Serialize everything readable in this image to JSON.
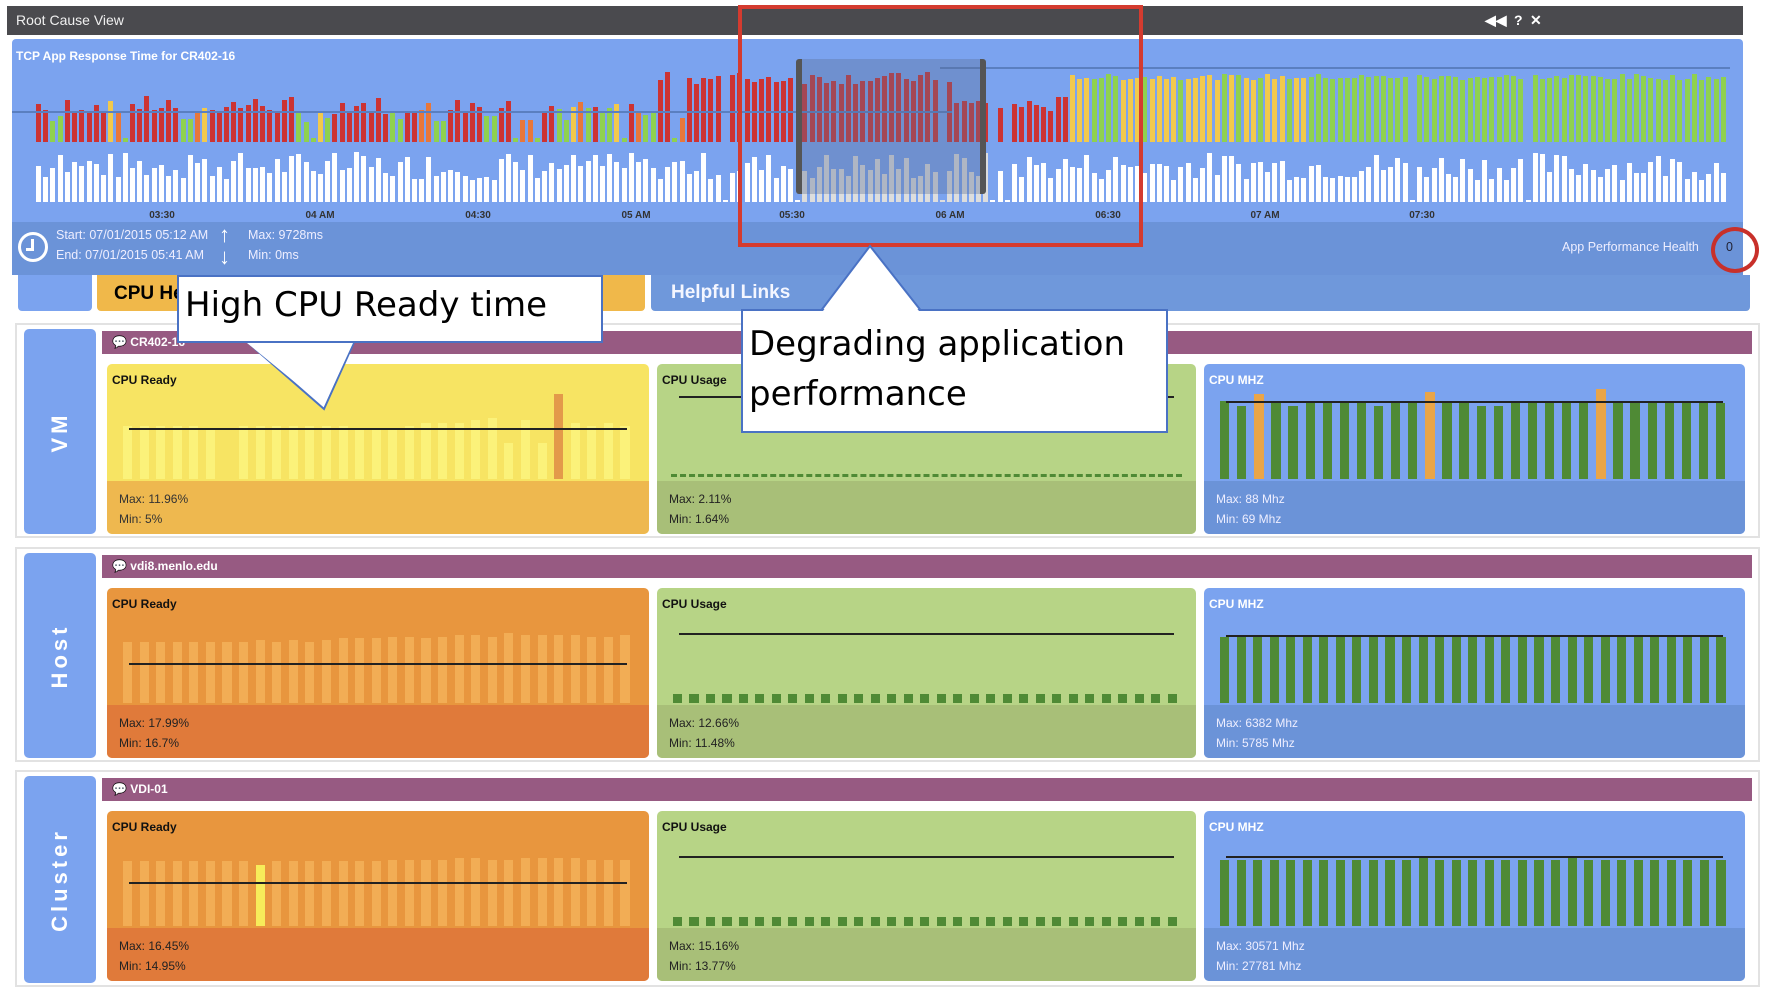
{
  "window": {
    "title": "Root Cause View",
    "controls": {
      "collapse": "◀◀",
      "help": "?",
      "close": "✕"
    }
  },
  "response_chart": {
    "title": "TCP App Response Time for CR402-16",
    "ticks": [
      "03:30",
      "04 AM",
      "04:30",
      "05 AM",
      "05:30",
      "06 AM",
      "06:30",
      "07 AM",
      "07:30"
    ],
    "status_sequence": "RRGGRRRRRRYOGRRRRRRRGGOYRRRRRRRRRRRRGGGYGRRRRRRRRGGRROOGGRRRRRGGRRGOOGRRGGYOGRGGYGROGGRRGORRRRR_RRRRRRRRR_RRRRRRRRRRRRRRRRRRR_RRRRRR_R_RRRRRRRRYYYGGGGYYYGYYYYGYYYYYGYGYYGYYYGYYGGGGGGGGGGGGGG_GGGGGGGGGGGGGGG_GGGGGGGGGGGGGGGGGGGGGGGGGGG",
    "status_colors": {
      "R": "#cc3333",
      "O": "#e8773a",
      "Y": "#f2c94c",
      "G": "#8fd14f"
    },
    "start": "Start: 07/01/2015 05:12 AM",
    "end": "End: 07/01/2015 05:41 AM",
    "max": "Max: 9728ms",
    "min": "Min: 0ms",
    "health_label": "App Performance Health",
    "health_value": "0"
  },
  "tabs": {
    "cpu_health": "CPU Health",
    "helpful_links": "Helpful Links"
  },
  "annotations": {
    "cpu_ready": "High CPU Ready time",
    "degrading": "Degrading application performance"
  },
  "rows": [
    {
      "label": "VM",
      "entity": "CR402-16",
      "panels": [
        {
          "title": "CPU Ready",
          "max": "Max: 11.96%",
          "min": "Min: 5%",
          "style": "yellow",
          "line": 58,
          "bars": [
            62,
            62,
            62,
            62,
            62,
            60,
            0,
            62,
            62,
            62,
            62,
            62,
            62,
            62,
            60,
            60,
            60,
            62,
            66,
            66,
            66,
            70,
            72,
            42,
            70,
            42,
            100,
            66,
            62,
            66,
            62
          ],
          "highlight": [
            26
          ]
        },
        {
          "title": "CPU Usage",
          "max": "Max: 2.11%",
          "min": "Min: 1.64%",
          "style": "green",
          "line": 95,
          "dashes": true,
          "bars": []
        },
        {
          "title": "CPU MHZ",
          "max": "Max: 88 Mhz",
          "min": "Min: 69 Mhz",
          "style": "blue",
          "line": 90,
          "bars": [
            92,
            86,
            100,
            92,
            86,
            92,
            92,
            90,
            92,
            86,
            92,
            92,
            102,
            90,
            92,
            86,
            86,
            92,
            92,
            92,
            92,
            92,
            106,
            92,
            92,
            92,
            92,
            92,
            90,
            90
          ],
          "highlight": [
            2,
            12,
            22
          ]
        }
      ]
    },
    {
      "label": "Host",
      "entity": "vdi8.menlo.edu",
      "panels": [
        {
          "title": "CPU Ready",
          "max": "Max: 17.99%",
          "min": "Min: 16.7%",
          "style": "orange",
          "line": 45,
          "bars": [
            72,
            72,
            72,
            72,
            72,
            72,
            72,
            72,
            74,
            72,
            74,
            72,
            74,
            76,
            76,
            76,
            78,
            78,
            76,
            78,
            80,
            80,
            78,
            82,
            80,
            80,
            80,
            80,
            78,
            78,
            80
          ]
        },
        {
          "title": "CPU Usage",
          "max": "Max: 12.66%",
          "min": "Min: 11.48%",
          "style": "green",
          "line": 80,
          "squares": true,
          "bars": [
            12,
            12,
            12,
            12,
            12,
            12,
            12,
            12,
            12,
            12,
            12,
            12,
            12,
            12,
            12,
            12,
            12,
            12,
            12,
            12,
            12,
            12,
            12,
            12,
            12,
            12,
            12,
            12,
            12,
            12,
            12
          ]
        },
        {
          "title": "CPU MHZ",
          "max": "Max: 6382 Mhz",
          "min": "Min: 5785 Mhz",
          "style": "blue",
          "line": 78,
          "bars": [
            78,
            78,
            78,
            78,
            78,
            78,
            78,
            78,
            78,
            78,
            78,
            78,
            78,
            78,
            78,
            78,
            78,
            78,
            80,
            78,
            78,
            78,
            78,
            80,
            78,
            80,
            78,
            78,
            78,
            80,
            78
          ]
        }
      ]
    },
    {
      "label": "Cluster",
      "entity": "VDI-01",
      "panels": [
        {
          "title": "CPU Ready",
          "max": "Max: 16.45%",
          "min": "Min: 14.95%",
          "style": "orange",
          "line": 50,
          "bars": [
            76,
            76,
            76,
            76,
            76,
            76,
            76,
            76,
            76,
            76,
            76,
            76,
            76,
            76,
            76,
            76,
            78,
            78,
            78,
            78,
            80,
            80,
            78,
            78,
            80,
            80,
            80,
            80,
            78,
            78,
            78
          ],
          "highlight": [
            8
          ],
          "hl_color": "#f7ec5a",
          "hl_height": 72
        },
        {
          "title": "CPU Usage",
          "max": "Max: 15.16%",
          "min": "Min: 13.77%",
          "style": "green",
          "line": 80,
          "squares": true,
          "bars": [
            12,
            12,
            12,
            12,
            12,
            12,
            12,
            12,
            12,
            12,
            12,
            12,
            12,
            12,
            12,
            12,
            12,
            12,
            12,
            12,
            12,
            12,
            12,
            12,
            12,
            12,
            12,
            12,
            12,
            12,
            12
          ]
        },
        {
          "title": "CPU MHZ",
          "max": "Max: 30571 Mhz",
          "min": "Min: 27781 Mhz",
          "style": "blue",
          "line": 80,
          "bars": [
            78,
            78,
            78,
            78,
            78,
            78,
            78,
            78,
            78,
            78,
            78,
            78,
            80,
            78,
            78,
            78,
            78,
            78,
            78,
            78,
            78,
            80,
            78,
            78,
            78,
            78,
            78,
            78,
            78,
            78,
            78
          ]
        }
      ]
    }
  ],
  "colors": {
    "purple_header": "#975a82",
    "panel_blue": "#7ba3ef",
    "callout_border": "#4a72c4",
    "highlight_red": "#d43b2f"
  }
}
